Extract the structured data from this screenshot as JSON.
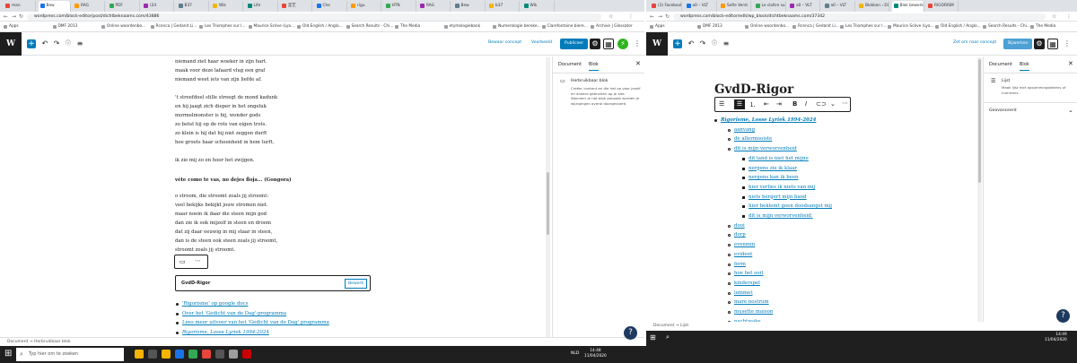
{
  "colors": {
    "wp_blue": "#007cba",
    "dark": "#1e1e1e",
    "taskbar": "#1f1f1f"
  },
  "left": {
    "tabs": [
      "man",
      "Bew",
      "RAG",
      "PDF",
      "(24",
      "B37",
      "Wik",
      "Life",
      "是艺",
      "Che",
      "rigu",
      "HTN",
      "RAG",
      "Bew",
      "b37",
      "Wik"
    ],
    "url": "wordpress.com/block-editor/post/dichtbeknaams.com/43886",
    "bookmarks": [
      "Apps",
      "DMF 2013",
      "Online woordenbo...",
      "Rcenca | Gedanit Li...",
      "Les Triomphes sur l...",
      "Maurice Scève (Lya...",
      "Old English / Anglo...",
      "Search Results - Chi...",
      "The Media",
      "etymologiebank",
      "Numerologie bereke...",
      "Clarefontaine biere...",
      "Archive | Glossator"
    ],
    "toolbar": {
      "save": "Bewaar concept",
      "preview": "Voorbeeld",
      "publish": "Publiceer"
    },
    "stanza1": [
      "niemand ziet haar woeker in zijn hart.",
      "maak voor deze lafaard vlug een graf",
      "niemand weet iets van zijn liefde af."
    ],
    "stanza2": [
      "'t streefdoel stille streegt de mond kadunk",
      "en hij jaagt zich dieper in het ongeluk",
      "mormelmonster is hij, wonder gods",
      "zo botst hij op de rots van eigen trots.",
      "zo klein is hij dat hij niet zeggen durft",
      "hoe groots haar schoonheid in hem turft."
    ],
    "line_alone": "ik zie mij zo en hoor het zwijgen.",
    "heading": "véte como te vas, no dejes floja... (Gongora)",
    "stanza3": [
      "o stroom, die stroomt zoals jij stroomt:",
      "veel bekijks bekijkt jouw stromen niet.",
      "maar noem ik daar die steen mijn god",
      "dan zie ik ook mijzelf in steen en droom",
      "dat zij daar eeuwig in mij staar in steen,",
      "dan is de steen ook steen zoals jij stroomt,",
      "stroomt zoals jij stroomt."
    ],
    "block_label": "GvdD-Rigor",
    "block_edit": "Bewerk",
    "links": [
      "'Rigorisme' op google docs",
      "Over het 'Gedicht van de Dag'-programma",
      "Lees meer uitvoer van het 'Gedicht van de Dag' programma",
      "Rigorisme, Losse Lyriek 1994-2024"
    ],
    "sidebar": {
      "tab1": "Document",
      "tab2": "Blok",
      "block_title": "Herbruikbaar blok",
      "block_desc": "Creëer content en die het op voor jezelf en andere gebruiken op je site. Wanneer je het blok aanpast worden je wijzigingen overal doorgevoerd."
    },
    "status": [
      "Document",
      "→",
      "Herbruikbaar blok"
    ]
  },
  "right": {
    "tabs": [
      "(3) Facebook",
      "a0 – VLT",
      "Sofie Verst",
      "Le cloître sur",
      "a0 – VLT",
      "a0 – VLT",
      "Blokken ‹ Di",
      "Blok bewerk",
      "RIGORISM"
    ],
    "url": "wordpress.com/block-editor/edit/wp_block/dichtbeknaams.com/37342",
    "bookmarks": [
      "Apps",
      "DMF 2013",
      "Online woordenbo...",
      "Rcenca | Gedanit Li...",
      "Les Triomphes sur l...",
      "Maurice Scève (Lya...",
      "Old English / Anglo...",
      "Search Results - Chi...",
      "The Media"
    ],
    "toolbar": {
      "save": "Zet om naar concept",
      "publish": "Bijwerken"
    },
    "title": "GvdD-Rigor",
    "list_top": "Rigorisme, Losse Lyriek 1994-2024",
    "list_level2": [
      "aanvang",
      "de allermooiste",
      "dit is mijn verworvenheid"
    ],
    "list_level3": [
      "dit land is niet het mijne",
      "nergens zie ik klaar",
      "nergens kan ik been",
      "hier verlies ik niets van mij",
      "niets bergert mijn band",
      "hier beklemt geen doodsangst mij",
      "dit is mijn verworvenheid:"
    ],
    "list_level2b": [
      "dooi",
      "dorp",
      "evenmin",
      "evident",
      "ferm",
      "hoe het ooit",
      "kinderspel",
      "lemmet",
      "mare nostrum",
      "musette maison",
      "nachtwake"
    ],
    "sidebar": {
      "tab1": "Document",
      "tab2": "Blok",
      "block_title": "Lijst",
      "block_desc": "Maak lijst met opsommingstekens of nummers.",
      "advanced": "Geavanceerd"
    },
    "status": [
      "Document",
      "→",
      "Lijst"
    ]
  },
  "taskbar": {
    "search": "Typ hier om te zoeken",
    "lang_left": "NLD",
    "time_left": "14:48",
    "date_left": "11/04/2020",
    "time_right": "14:49",
    "date_right": "11/04/2020"
  }
}
